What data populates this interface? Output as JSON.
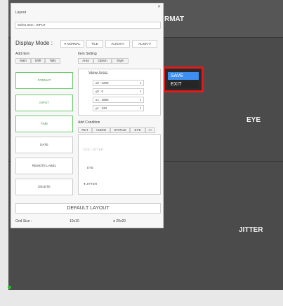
{
  "canvas": {
    "panes": [
      {
        "label": "FORMAT",
        "visible_label": "RMAT"
      },
      {
        "label": "EYE"
      },
      {
        "label": "JITTER"
      }
    ]
  },
  "popup": {
    "save": "SAVE",
    "exit": "EXIT"
  },
  "layout_panel": {
    "title": "Layout",
    "select_item": "Select Item : INPUT",
    "display_mode_label": "Display Mode :",
    "modes": [
      "NORMAL",
      "TILE",
      "ALIGN-H",
      "ALIGN-V"
    ],
    "selected_mode": "NORMAL",
    "add_item_title": "Add Item",
    "add_item_tabs": [
      "Main",
      "Shift",
      "Tally"
    ],
    "items": [
      "FORMAT",
      "INPUT",
      "TIME",
      "DATE",
      "REMOTE LABEL",
      "DELETE"
    ],
    "item_setting_title": "Item Setting",
    "setting_tabs": [
      "Area",
      "Option",
      "Style"
    ],
    "view_area_title": "View Area",
    "coords": [
      {
        "label": "x0 :",
        "value": "1200"
      },
      {
        "label": "y0 :",
        "value": "0"
      },
      {
        "label": "x1 :",
        "value": "1560"
      },
      {
        "label": "y1 :",
        "value": "120"
      }
    ],
    "add_condition_title": "Add Condition",
    "condition_tabs": [
      "RCT",
      "AUDIO",
      "STATUS",
      "EYE",
      ">>"
    ],
    "conditions": [
      "EYE / JITTER",
      "EYE",
      "JITTER"
    ],
    "selected_condition": "JITTER",
    "default_layout": "DEFAULT LAYOUT",
    "grid_size_label": "Grid Size :",
    "grid_size_value": "10x10",
    "grid_size_alt": "20x20"
  }
}
